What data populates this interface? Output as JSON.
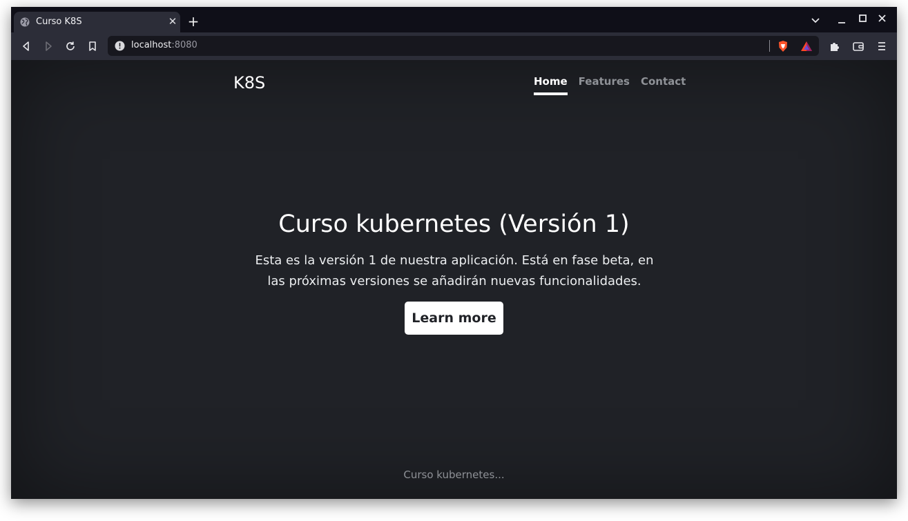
{
  "browser": {
    "tab": {
      "title": "Curso K8S",
      "close_glyph": "✕",
      "favicon": "globe-icon"
    },
    "new_tab_glyph": "+",
    "window_controls": [
      "chevron-down-icon",
      "minimize-icon",
      "maximize-icon",
      "close-icon"
    ],
    "toolbar": {
      "buttons": [
        "back-icon",
        "forward-icon",
        "reload-icon",
        "bookmark-icon"
      ],
      "url": {
        "host": "localhost",
        "port": ":8080"
      },
      "extensions": [
        "brave-shield-icon",
        "brave-rewards-icon",
        "puzzle-icon",
        "wallet-icon",
        "menu-icon"
      ]
    },
    "colors": {
      "tabstrip": "#0f0f18",
      "toolbar": "#2c2d38",
      "urlbar": "#17171e"
    }
  },
  "site": {
    "brand": "K8S",
    "nav": [
      {
        "label": "Home",
        "active": true
      },
      {
        "label": "Features",
        "active": false
      },
      {
        "label": "Contact",
        "active": false
      }
    ],
    "hero": {
      "title": "Curso kubernetes (Versión 1)",
      "lead": "Esta es la versión 1 de nuestra aplicación. Está en fase beta, en las próximas versiones se añadirán nuevas funcionalidades.",
      "button": "Learn more"
    },
    "footer": "Curso kubernetes...",
    "colors": {
      "background": "#202227",
      "text": "#ffffff",
      "muted": "#8e9196"
    }
  }
}
